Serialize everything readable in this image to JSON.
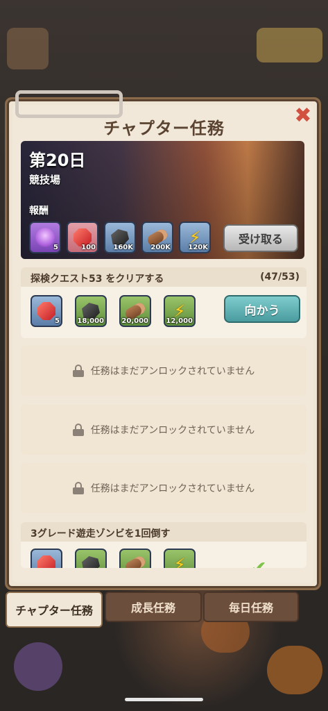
{
  "window": {
    "title": "チャプター任務",
    "close_icon": "close-icon"
  },
  "banner": {
    "day": "第20日",
    "place": "競技場",
    "reward_label": "報酬",
    "rewards": [
      {
        "icon": "hero-icon",
        "count": "5"
      },
      {
        "icon": "gem-icon",
        "count": "100"
      },
      {
        "icon": "coal-icon",
        "count": "160K"
      },
      {
        "icon": "wood-icon",
        "count": "200K"
      },
      {
        "icon": "lightning-icon",
        "count": "120K"
      }
    ],
    "receive_button": "受け取る"
  },
  "quest1": {
    "title": "探検クエスト53 をクリアする",
    "progress": "(47/53)",
    "rewards": [
      {
        "icon": "gem-icon",
        "count": "5"
      },
      {
        "icon": "coal-icon",
        "count": "18,000"
      },
      {
        "icon": "wood-icon",
        "count": "20,000"
      },
      {
        "icon": "lightning-icon",
        "count": "12,000"
      }
    ],
    "go_button": "向かう"
  },
  "locked_text": "任務はまだアンロックされていません",
  "quest5": {
    "title": "3グレード遊走ゾンビを1回倒す"
  },
  "tabs": [
    {
      "label": "チャプター任務"
    },
    {
      "label": "成長任務"
    },
    {
      "label": "毎日任務"
    }
  ]
}
